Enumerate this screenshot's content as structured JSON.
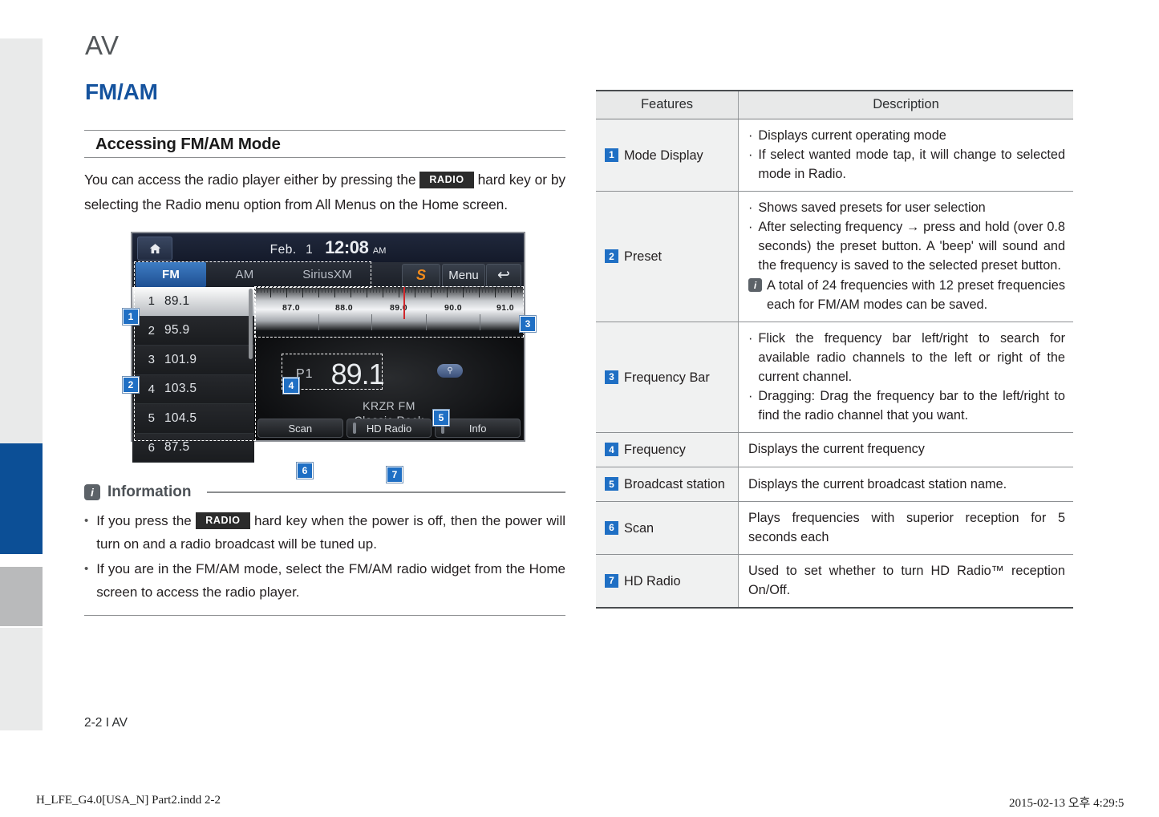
{
  "page": {
    "chapter_title": "AV",
    "section_title": "FM/AM",
    "subsection_title": "Accessing FM/AM Mode",
    "intro_before": "You can access the radio player either by pressing the",
    "intro_key": "RADIO",
    "intro_after": "hard key or by selecting the Radio menu option from All Menus on the Home screen.",
    "footer": "2-2 I AV"
  },
  "print_footer": {
    "left": "H_LFE_G4.0[USA_N] Part2.indd   2-2",
    "right": "2015-02-13   오후 4:29:5"
  },
  "radio_screen": {
    "home_icon": "home-icon",
    "date": "Feb.",
    "day": "1",
    "time": "12:08",
    "ampm": "AM",
    "tabs": [
      {
        "label": "FM",
        "active": true
      },
      {
        "label": "AM",
        "active": false
      },
      {
        "label": "SiriusXM",
        "active": false
      }
    ],
    "sirius_logo": "S",
    "menu_label": "Menu",
    "back_icon": "back-arrow-icon",
    "presets": [
      {
        "num": "1",
        "freq": "89.1",
        "selected": true
      },
      {
        "num": "2",
        "freq": "95.9",
        "selected": false
      },
      {
        "num": "3",
        "freq": "101.9",
        "selected": false
      },
      {
        "num": "4",
        "freq": "103.5",
        "selected": false
      },
      {
        "num": "5",
        "freq": "104.5",
        "selected": false
      },
      {
        "num": "6",
        "freq": "87.5",
        "selected": false
      }
    ],
    "frequency_ticks": [
      "87.0",
      "88.0",
      "89.0",
      "90.0",
      "91.0"
    ],
    "preset_label": "P1",
    "frequency": "89.1",
    "hd_pill_icon": "hd-search-icon",
    "station_name": "KRZR FM",
    "station_genre": "Classic Rock",
    "softkeys": [
      {
        "label": "Scan",
        "led": false
      },
      {
        "label": "HD Radio",
        "led": true
      },
      {
        "label": "Info",
        "led": true
      }
    ],
    "callouts": [
      "1",
      "2",
      "3",
      "4",
      "5",
      "6",
      "7"
    ]
  },
  "information": {
    "badge": "i",
    "title": "Information",
    "items": [
      {
        "before": "If you press the",
        "key": "RADIO",
        "after": "hard key when the power is off, then the power will turn on and a radio broadcast will be tuned up."
      },
      {
        "before": "",
        "key": "",
        "after": "If you are in the FM/AM mode, select the FM/AM radio widget from the Home screen to access the radio player."
      }
    ]
  },
  "table": {
    "headers": {
      "features": "Features",
      "description": "Description"
    },
    "rows": [
      {
        "num": "1",
        "feature": "Mode Display",
        "bullets": [
          "Displays current operating mode",
          "If select wanted mode tap, it will change to selected mode in Radio."
        ],
        "note": null
      },
      {
        "num": "2",
        "feature": "Preset",
        "bullets": [
          "Shows saved presets for user selection",
          "After selecting frequency → press and hold (over 0.8 seconds) the preset button. A 'beep' will sound and the frequency is saved to the selected preset button."
        ],
        "note": "A total of 24 frequencies with 12 preset frequencies each for FM/AM modes can be saved."
      },
      {
        "num": "3",
        "feature": "Frequency Bar",
        "bullets": [
          "Flick the frequency bar left/right to search for available radio channels to the left or right of the current channel.",
          "Dragging: Drag the frequency bar to the left/right to find the radio channel that you want."
        ],
        "note": null
      },
      {
        "num": "4",
        "feature": "Frequency",
        "plain": "Displays the current frequency",
        "bullets": [],
        "note": null
      },
      {
        "num": "5",
        "feature": "Broadcast station",
        "plain": "Displays the current broadcast station name.",
        "bullets": [],
        "note": null
      },
      {
        "num": "6",
        "feature": "Scan",
        "plain": "Plays frequencies with superior reception for 5 seconds each",
        "bullets": [],
        "note": null
      },
      {
        "num": "7",
        "feature": "HD Radio",
        "plain": "Used to set whether to turn HD Radio™ reception On/Off.",
        "bullets": [],
        "note": null
      }
    ]
  },
  "colors": {
    "section_blue": "#15539e",
    "edge_blue": "#0c4f96",
    "callout_blue": "#1f6fc4"
  }
}
